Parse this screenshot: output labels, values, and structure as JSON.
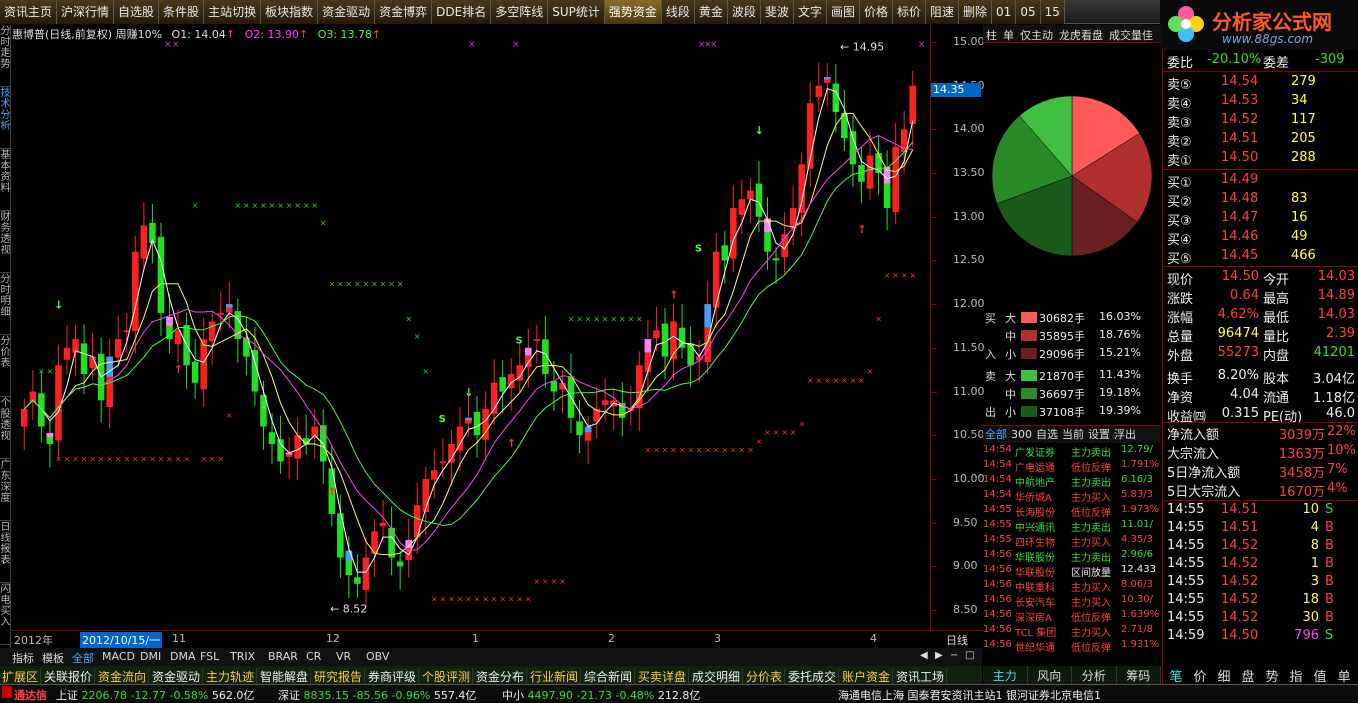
{
  "topbar": {
    "items": [
      "资讯主页",
      "沪深行情",
      "自选股",
      "条件股",
      "主站切换",
      "板块指数",
      "资金驱动",
      "资金博弈",
      "DDE排名",
      "多空阵线",
      "SUP统计",
      "强势资金",
      "线段",
      "黄金",
      "波段",
      "斐波",
      "文字",
      "画图",
      "价格",
      "标价",
      "阻速",
      "删除",
      "01",
      "05",
      "15"
    ]
  },
  "logo": {
    "brand": "分析家公式网",
    "url": "www.88gs.com"
  },
  "sidebar": {
    "tabs": [
      "分时走势",
      "技术分析",
      "基本资料",
      "财务透视",
      "分时明细",
      "分价表",
      "个股透视",
      "广东深度",
      "日线报表",
      "闪电买入"
    ]
  },
  "chart": {
    "title": "惠博普(日线,前复权) 周赚10%",
    "o1": "O1: 14.04",
    "o2": "O2: 13.90",
    "o3": "O3: 13.78",
    "hi_label": "14.95",
    "lo_label": "8.52",
    "signal": "S",
    "current_price": "14.35"
  },
  "yaxis": {
    "ticks": [
      "15.00",
      "14.50",
      "14.00",
      "13.50",
      "13.00",
      "12.50",
      "12.00",
      "11.50",
      "11.00",
      "10.50",
      "10.00",
      "9.50",
      "9.00",
      "8.50"
    ]
  },
  "xaxis": {
    "labels": [
      "2012年",
      "2012/10/15/一",
      "11",
      "12",
      "1",
      "2",
      "3",
      "4"
    ],
    "period": "日线"
  },
  "indicator_tabs": [
    "指标",
    "模板",
    "全部",
    "MACD",
    "DMI",
    "DMA",
    "FSL",
    "TRIX",
    "BRAR",
    "CR",
    "VR",
    "OBV"
  ],
  "func_tabs": [
    "扩展区",
    "关联报价",
    "资金流向",
    "资金驱动",
    "主力轨迹",
    "智能解盘",
    "研究报告",
    "券商评级",
    "个股评测",
    "资金分布",
    "行业新闻",
    "综合新闻",
    "买卖详盘",
    "成交明细",
    "分价表",
    "委托成交",
    "账户资金",
    "资讯工场"
  ],
  "status": {
    "app": "通达信",
    "sh": "上证",
    "sh_val": "2206.78",
    "sh_chg": "-12.77",
    "sh_pct": "-0.58%",
    "sh_amt": "562.0亿",
    "sz": "深证",
    "sz_val": "8835.15",
    "sz_chg": "-85.56",
    "sz_pct": "-0.96%",
    "sz_amt": "557.4亿",
    "zx": "中小",
    "zx_val": "4497.90",
    "zx_chg": "-21.73",
    "zx_pct": "-0.48%",
    "zx_amt": "212.8亿",
    "server": "海通电信上海  国泰君安资讯主站1  银河证券北京电信1"
  },
  "midtabs": [
    "柱",
    "单",
    "仅主动",
    "龙虎看盘",
    "成交量佳"
  ],
  "flow": {
    "rows": [
      {
        "side": "买",
        "size": "大",
        "vol": "30682手",
        "pct": "16.03%",
        "color": "#ff5a5a"
      },
      {
        "side": "",
        "size": "中",
        "vol": "35895手",
        "pct": "18.76%",
        "color": "#b03030"
      },
      {
        "side": "入",
        "size": "小",
        "vol": "29096手",
        "pct": "15.21%",
        "color": "#6a2020"
      },
      {
        "side": "卖",
        "size": "大",
        "vol": "21870手",
        "pct": "11.43%",
        "color": "#40c040"
      },
      {
        "side": "",
        "size": "中",
        "vol": "36697手",
        "pct": "19.18%",
        "color": "#2a8a2a"
      },
      {
        "side": "出",
        "size": "小",
        "vol": "37108手",
        "pct": "19.39%",
        "color": "#1a5a1a"
      }
    ]
  },
  "pie": [
    16.03,
    18.76,
    15.21,
    19.39,
    19.18,
    11.43
  ],
  "tickfilter": [
    "全部",
    "300",
    "自选",
    "当前",
    "设置",
    "浮出"
  ],
  "ticks": [
    {
      "t": "14:54",
      "n": "广发证券",
      "a": "主力卖出",
      "v": "12.79/",
      "c": "grn"
    },
    {
      "t": "14:54",
      "n": "广电运通",
      "a": "低位反弹",
      "v": "1.791%",
      "c": "red"
    },
    {
      "t": "14:54",
      "n": "中航地产",
      "a": "主力卖出",
      "v": "6.16/3",
      "c": "grn"
    },
    {
      "t": "14:54",
      "n": "华侨城A",
      "a": "主力买入",
      "v": "5.83/3",
      "c": "red"
    },
    {
      "t": "14:55",
      "n": "长海股份",
      "a": "低位反弹",
      "v": "1.973%",
      "c": "red"
    },
    {
      "t": "14:55",
      "n": "中兴通讯",
      "a": "主力卖出",
      "v": "11.01/",
      "c": "grn"
    },
    {
      "t": "14:55",
      "n": "四环生物",
      "a": "主力买入",
      "v": "4.35/3",
      "c": "red"
    },
    {
      "t": "14:56",
      "n": "华联股份",
      "a": "主力卖出",
      "v": "2.96/6",
      "c": "grn"
    },
    {
      "t": "14:56",
      "n": "华联股份",
      "a": "区间放量",
      "v": "12.433",
      "c": "wht"
    },
    {
      "t": "14:56",
      "n": "中联重科",
      "a": "主力买入",
      "v": "8.06/3",
      "c": "red"
    },
    {
      "t": "14:56",
      "n": "长安汽车",
      "a": "主力买入",
      "v": "10.30/",
      "c": "red"
    },
    {
      "t": "14:56",
      "n": "深深房A",
      "a": "低位反弹",
      "v": "1.639%",
      "c": "red"
    },
    {
      "t": "14:56",
      "n": "TCL 集团",
      "a": "主力买入",
      "v": "2.71/8",
      "c": "red"
    },
    {
      "t": "14:56",
      "n": "世纪华通",
      "a": "低位反弹",
      "v": "1.931%",
      "c": "red"
    }
  ],
  "bottomtabs": [
    "主力",
    "风向",
    "分析",
    "筹码"
  ],
  "right": {
    "weibi": "委比",
    "weibi_v": "-20.10%",
    "weicha": "委差",
    "weicha_v": "-309",
    "sells": [
      {
        "l": "卖⑤",
        "p": "14.54",
        "v": "279"
      },
      {
        "l": "卖④",
        "p": "14.53",
        "v": "34"
      },
      {
        "l": "卖③",
        "p": "14.52",
        "v": "117"
      },
      {
        "l": "卖②",
        "p": "14.51",
        "v": "205"
      },
      {
        "l": "卖①",
        "p": "14.50",
        "v": "288"
      }
    ],
    "buys": [
      {
        "l": "买①",
        "p": "14.49",
        "v": ""
      },
      {
        "l": "买②",
        "p": "14.48",
        "v": "83"
      },
      {
        "l": "买③",
        "p": "14.47",
        "v": "16"
      },
      {
        "l": "买④",
        "p": "14.46",
        "v": "49"
      },
      {
        "l": "买⑤",
        "p": "14.45",
        "v": "466"
      }
    ],
    "stats": [
      [
        "现价",
        "14.50",
        "今开",
        "14.03"
      ],
      [
        "涨跌",
        "0.64",
        "最高",
        "14.89"
      ],
      [
        "涨幅",
        "4.62%",
        "最低",
        "14.03"
      ],
      [
        "总量",
        "96474",
        "量比",
        "2.39"
      ],
      [
        "外盘",
        "55273",
        "内盘",
        "41201"
      ],
      [
        "换手",
        "8.20%",
        "股本",
        "3.04亿"
      ],
      [
        "净资",
        "4.04",
        "流通",
        "1.18亿"
      ],
      [
        "收益㈣",
        "0.315",
        "PE(动)",
        "46.0"
      ]
    ],
    "flows": [
      [
        "净流入额",
        "3039万",
        "22%"
      ],
      [
        "大宗流入",
        "1363万",
        "10%"
      ],
      [
        "5日净流入额",
        "3458万",
        "7%"
      ],
      [
        "5日大宗流入",
        "1670万",
        "4%"
      ]
    ],
    "trades": [
      [
        "14:55",
        "14.51",
        "10",
        "S"
      ],
      [
        "14:55",
        "14.51",
        "4",
        "B"
      ],
      [
        "14:55",
        "14.52",
        "8",
        "B"
      ],
      [
        "14:55",
        "14.52",
        "1",
        "B"
      ],
      [
        "14:55",
        "14.52",
        "3",
        "B"
      ],
      [
        "14:55",
        "14.52",
        "18",
        "B"
      ],
      [
        "14:55",
        "14.52",
        "30",
        "B"
      ],
      [
        "14:59",
        "14.50",
        "796",
        "S"
      ]
    ],
    "tabs": [
      "笔",
      "价",
      "细",
      "盘",
      "势",
      "指",
      "值",
      "单"
    ]
  }
}
